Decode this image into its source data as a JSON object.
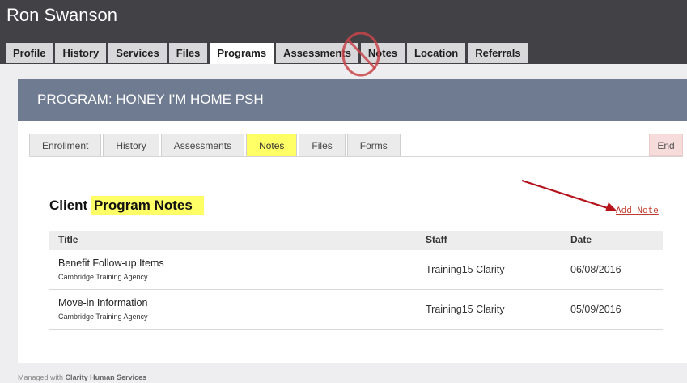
{
  "client": {
    "name": "Ron Swanson"
  },
  "main_tabs": [
    {
      "label": "Profile"
    },
    {
      "label": "History"
    },
    {
      "label": "Services"
    },
    {
      "label": "Files"
    },
    {
      "label": "Programs",
      "active": true
    },
    {
      "label": "Assessments"
    },
    {
      "label": "Notes"
    },
    {
      "label": "Location"
    },
    {
      "label": "Referrals"
    }
  ],
  "program": {
    "title": "PROGRAM: HONEY I'M HOME PSH"
  },
  "sub_tabs": [
    {
      "label": "Enrollment"
    },
    {
      "label": "History"
    },
    {
      "label": "Assessments"
    },
    {
      "label": "Notes",
      "active": true
    },
    {
      "label": "Files"
    },
    {
      "label": "Forms"
    }
  ],
  "end_button": {
    "label": "End"
  },
  "notes_section": {
    "title_prefix": "Client",
    "title_highlight": "Program Notes",
    "add_note_label": "Add Note"
  },
  "table": {
    "headers": {
      "title": "Title",
      "staff": "Staff",
      "date": "Date"
    },
    "rows": [
      {
        "title": "Benefit Follow-up Items",
        "agency": "Cambridge Training Agency",
        "staff": "Training15 Clarity",
        "date": "06/08/2016"
      },
      {
        "title": "Move-in Information",
        "agency": "Cambridge Training Agency",
        "staff": "Training15 Clarity",
        "date": "05/09/2016"
      }
    ]
  },
  "footer": {
    "prefix": "Managed with",
    "brand": "Clarity Human Services"
  },
  "colors": {
    "topbar": "#414146",
    "program_header": "#6e7b91",
    "highlight": "#ffff66",
    "annotation_red": "#c0392b",
    "end_button_bg": "#f7dcdc"
  },
  "icons": {
    "no_sign": "prohibited-icon",
    "arrow": "annotation-arrow-icon"
  }
}
